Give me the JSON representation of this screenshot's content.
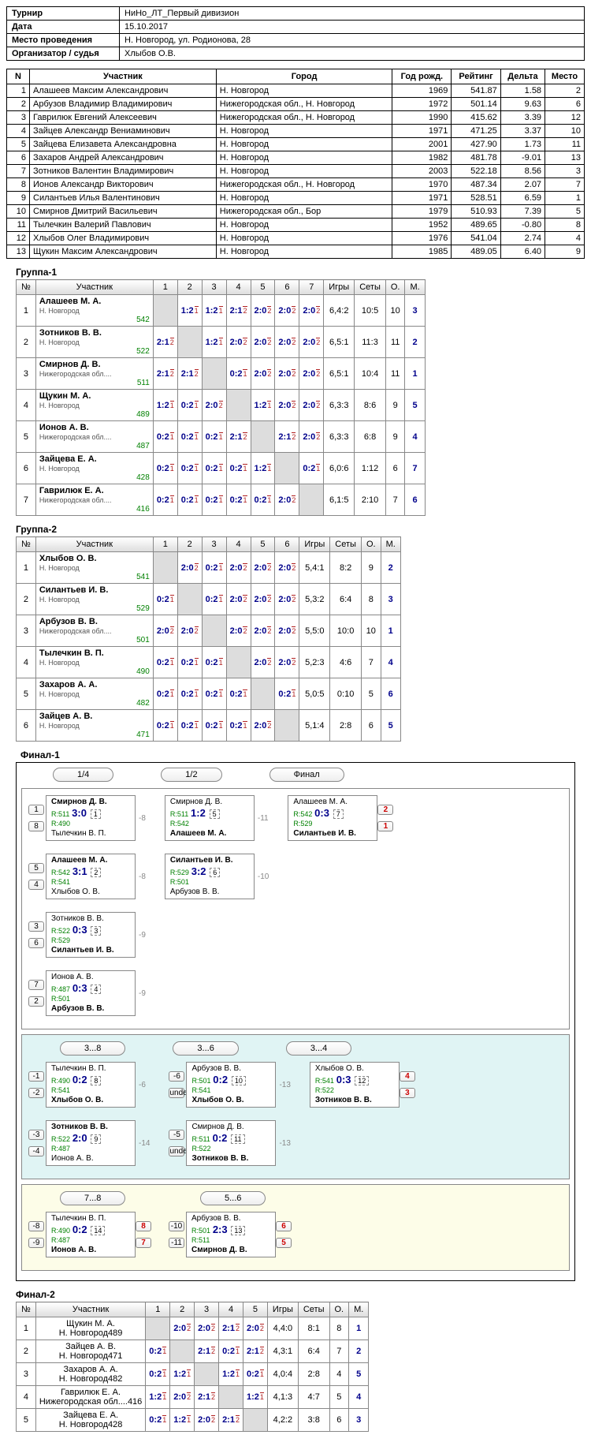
{
  "info": {
    "tournament_label": "Турнир",
    "tournament": "НиНо_ЛТ_Первый дивизион",
    "date_label": "Дата",
    "date": "15.10.2017",
    "venue_label": "Место проведения",
    "venue": "Н. Новгород, ул. Родионова, 28",
    "organizer_label": "Организатор / судья",
    "organizer": "Хлыбов О.В."
  },
  "main": {
    "headers": {
      "n": "N",
      "participant": "Участник",
      "city": "Город",
      "year": "Год рожд.",
      "rating": "Рейтинг",
      "delta": "Дельта",
      "place": "Место"
    },
    "rows": [
      {
        "n": 1,
        "name": "Алашеев Максим Александрович",
        "city": "Н. Новгород",
        "year": 1969,
        "rating": "541.87",
        "delta": "1.58",
        "place": 2
      },
      {
        "n": 2,
        "name": "Арбузов Владимир Владимирович",
        "city": "Нижегородская обл., Н. Новгород",
        "year": 1972,
        "rating": "501.14",
        "delta": "9.63",
        "place": 6
      },
      {
        "n": 3,
        "name": "Гаврилюк Евгений Алексеевич",
        "city": "Нижегородская обл., Н. Новгород",
        "year": 1990,
        "rating": "415.62",
        "delta": "3.39",
        "place": 12
      },
      {
        "n": 4,
        "name": "Зайцев Александр Вениаминович",
        "city": "Н. Новгород",
        "year": 1971,
        "rating": "471.25",
        "delta": "3.37",
        "place": 10
      },
      {
        "n": 5,
        "name": "Зайцева Елизавета Александровна",
        "city": "Н. Новгород",
        "year": 2001,
        "rating": "427.90",
        "delta": "1.73",
        "place": 11
      },
      {
        "n": 6,
        "name": "Захаров Андрей Александрович",
        "city": "Н. Новгород",
        "year": 1982,
        "rating": "481.78",
        "delta": "-9.01",
        "place": 13
      },
      {
        "n": 7,
        "name": "Зотников Валентин Владимирович",
        "city": "Н. Новгород",
        "year": 2003,
        "rating": "522.18",
        "delta": "8.56",
        "place": 3
      },
      {
        "n": 8,
        "name": "Ионов Александр Викторович",
        "city": "Нижегородская обл., Н. Новгород",
        "year": 1970,
        "rating": "487.34",
        "delta": "2.07",
        "place": 7
      },
      {
        "n": 9,
        "name": "Силантьев Илья Валентинович",
        "city": "Н. Новгород",
        "year": 1971,
        "rating": "528.51",
        "delta": "6.59",
        "place": 1
      },
      {
        "n": 10,
        "name": "Смирнов Дмитрий Васильевич",
        "city": "Нижегородская обл., Бор",
        "year": 1979,
        "rating": "510.93",
        "delta": "7.39",
        "place": 5
      },
      {
        "n": 11,
        "name": "Тылечкин Валерий Павлович",
        "city": "Н. Новгород",
        "year": 1952,
        "rating": "489.65",
        "delta": "-0.80",
        "place": 8
      },
      {
        "n": 12,
        "name": "Хлыбов Олег Владимирович",
        "city": "Н. Новгород",
        "year": 1976,
        "rating": "541.04",
        "delta": "2.74",
        "place": 4
      },
      {
        "n": 13,
        "name": "Щукин Максим Александрович",
        "city": "Н. Новгород",
        "year": 1985,
        "rating": "489.05",
        "delta": "6.40",
        "place": 9
      }
    ]
  },
  "groups": [
    {
      "title": "Группа-1",
      "cols": 7,
      "headers": {
        "n": "№",
        "p": "Участник",
        "g": "Игры",
        "s": "Сеты",
        "o": "О.",
        "m": "М."
      },
      "rows": [
        {
          "n": 1,
          "name": "Алашеев М. А.",
          "city": "Н. Новгород",
          "rt": 542,
          "cells": [
            "",
            "1:2/1",
            "1:2/1",
            "2:1/2",
            "2:0/2",
            "2:0/2",
            "2:0/2"
          ],
          "g": "6,4:2",
          "s": "10:5",
          "o": 10,
          "m": 3
        },
        {
          "n": 2,
          "name": "Зотников В. В.",
          "city": "Н. Новгород",
          "rt": 522,
          "cells": [
            "2:1/2",
            "",
            "1:2/1",
            "2:0/2",
            "2:0/2",
            "2:0/2",
            "2:0/2"
          ],
          "g": "6,5:1",
          "s": "11:3",
          "o": 11,
          "m": 2
        },
        {
          "n": 3,
          "name": "Смирнов Д. В.",
          "city": "Нижегородская обл....",
          "rt": 511,
          "cells": [
            "2:1/2",
            "2:1/2",
            "",
            "0:2/1",
            "2:0/2",
            "2:0/2",
            "2:0/2"
          ],
          "g": "6,5:1",
          "s": "10:4",
          "o": 11,
          "m": 1
        },
        {
          "n": 4,
          "name": "Щукин М. А.",
          "city": "Н. Новгород",
          "rt": 489,
          "cells": [
            "1:2/1",
            "0:2/1",
            "2:0/2",
            "",
            "1:2/1",
            "2:0/2",
            "2:0/2"
          ],
          "g": "6,3:3",
          "s": "8:6",
          "o": 9,
          "m": 5
        },
        {
          "n": 5,
          "name": "Ионов А. В.",
          "city": "Нижегородская обл....",
          "rt": 487,
          "cells": [
            "0:2/1",
            "0:2/1",
            "0:2/1",
            "2:1/2",
            "",
            "2:1/2",
            "2:0/2"
          ],
          "g": "6,3:3",
          "s": "6:8",
          "o": 9,
          "m": 4
        },
        {
          "n": 6,
          "name": "Зайцева Е. А.",
          "city": "Н. Новгород",
          "rt": 428,
          "cells": [
            "0:2/1",
            "0:2/1",
            "0:2/1",
            "0:2/1",
            "1:2/1",
            "",
            "0:2/1"
          ],
          "g": "6,0:6",
          "s": "1:12",
          "o": 6,
          "m": 7
        },
        {
          "n": 7,
          "name": "Гаврилюк Е. А.",
          "city": "Нижегородская обл....",
          "rt": 416,
          "cells": [
            "0:2/1",
            "0:2/1",
            "0:2/1",
            "0:2/1",
            "0:2/1",
            "2:0/2",
            ""
          ],
          "g": "6,1:5",
          "s": "2:10",
          "o": 7,
          "m": 6
        }
      ]
    },
    {
      "title": "Группа-2",
      "cols": 6,
      "headers": {
        "n": "№",
        "p": "Участник",
        "g": "Игры",
        "s": "Сеты",
        "o": "О.",
        "m": "М."
      },
      "rows": [
        {
          "n": 1,
          "name": "Хлыбов О. В.",
          "city": "Н. Новгород",
          "rt": 541,
          "cells": [
            "",
            "2:0/2",
            "0:2/1",
            "2:0/2",
            "2:0/2",
            "2:0/2"
          ],
          "g": "5,4:1",
          "s": "8:2",
          "o": 9,
          "m": 2
        },
        {
          "n": 2,
          "name": "Силантьев И. В.",
          "city": "Н. Новгород",
          "rt": 529,
          "cells": [
            "0:2/1",
            "",
            "0:2/1",
            "2:0/2",
            "2:0/2",
            "2:0/2"
          ],
          "g": "5,3:2",
          "s": "6:4",
          "o": 8,
          "m": 3
        },
        {
          "n": 3,
          "name": "Арбузов В. В.",
          "city": "Нижегородская обл....",
          "rt": 501,
          "cells": [
            "2:0/2",
            "2:0/2",
            "",
            "2:0/2",
            "2:0/2",
            "2:0/2"
          ],
          "g": "5,5:0",
          "s": "10:0",
          "o": 10,
          "m": 1
        },
        {
          "n": 4,
          "name": "Тылечкин В. П.",
          "city": "Н. Новгород",
          "rt": 490,
          "cells": [
            "0:2/1",
            "0:2/1",
            "0:2/1",
            "",
            "2:0/2",
            "2:0/2"
          ],
          "g": "5,2:3",
          "s": "4:6",
          "o": 7,
          "m": 4
        },
        {
          "n": 5,
          "name": "Захаров А. А.",
          "city": "Н. Новгород",
          "rt": 482,
          "cells": [
            "0:2/1",
            "0:2/1",
            "0:2/1",
            "0:2/1",
            "",
            "0:2/1"
          ],
          "g": "5,0:5",
          "s": "0:10",
          "o": 5,
          "m": 6
        },
        {
          "n": 6,
          "name": "Зайцев А. В.",
          "city": "Н. Новгород",
          "rt": 471,
          "cells": [
            "0:2/1",
            "0:2/1",
            "0:2/1",
            "0:2/1",
            "2:0/2",
            ""
          ],
          "g": "5,1:4",
          "s": "2:8",
          "o": 6,
          "m": 5
        }
      ]
    }
  ],
  "final1": {
    "title": "Финал-1",
    "rounds": [
      "1/4",
      "1/2",
      "Финал"
    ],
    "qf": [
      {
        "s1": "1",
        "s2": "8",
        "p1": "Смирнов Д. В.",
        "r1": "R:511",
        "p2": "Тылечкин В. П.",
        "r2": "R:490",
        "score": "3:0",
        "mnum": "1",
        "diff": "-8",
        "win": 1
      },
      {
        "s1": "5",
        "s2": "4",
        "p1": "Алашеев М. А.",
        "r1": "R:542",
        "p2": "Хлыбов О. В.",
        "r2": "R:541",
        "score": "3:1",
        "mnum": "2",
        "diff": "-8",
        "win": 1
      },
      {
        "s1": "3",
        "s2": "6",
        "p1": "Зотников В. В.",
        "r1": "R:522",
        "p2": "Силантьев И. В.",
        "r2": "R:529",
        "score": "0:3",
        "mnum": "3",
        "diff": "-9",
        "win": 2
      },
      {
        "s1": "7",
        "s2": "2",
        "p1": "Ионов А. В.",
        "r1": "R:487",
        "p2": "Арбузов В. В.",
        "r2": "R:501",
        "score": "0:3",
        "mnum": "4",
        "diff": "-9",
        "win": 2
      }
    ],
    "sf": [
      {
        "p1": "Смирнов Д. В.",
        "r1": "R:511",
        "p2": "Алашеев М. А.",
        "r2": "R:542",
        "score": "1:2",
        "mnum": "5",
        "diff": "-11",
        "win": 2
      },
      {
        "p1": "Силантьев И. В.",
        "r1": "R:529",
        "p2": "Арбузов В. В.",
        "r2": "R:501",
        "score": "3:2",
        "mnum": "6",
        "diff": "-10",
        "win": 1
      }
    ],
    "f": {
      "p1": "Алашеев М. А.",
      "r1": "R:542",
      "p2": "Силантьев И. В.",
      "r2": "R:529",
      "score": "0:3",
      "mnum": "7",
      "s1": "2",
      "s2": "1",
      "win": 2
    },
    "cons1": {
      "label1": "3...8",
      "label2": "3...6",
      "label3": "3...4",
      "r1": [
        {
          "s1": "-1",
          "s2": "-2",
          "p1": "Тылечкин В. П.",
          "r1": "R:490",
          "p2": "Хлыбов О. В.",
          "r2": "R:541",
          "score": "0:2",
          "mnum": "8",
          "diff": "-6",
          "win": 2
        },
        {
          "s1": "-3",
          "s2": "-4",
          "p1": "Зотников В. В.",
          "r1": "R:522",
          "p2": "Ионов А. В.",
          "r2": "R:487",
          "score": "2:0",
          "mnum": "9",
          "diff": "-14",
          "win": 1
        }
      ],
      "r2": [
        {
          "s1": "-6",
          "p1": "Арбузов В. В.",
          "r1": "R:501",
          "p2": "Хлыбов О. В.",
          "r2": "R:541",
          "score": "0:2",
          "mnum": "10",
          "diff": "-13",
          "win": 2
        },
        {
          "s1": "-5",
          "p1": "Смирнов Д. В.",
          "r1": "R:511",
          "p2": "Зотников В. В.",
          "r2": "R:522",
          "score": "0:2",
          "mnum": "11",
          "diff": "-13",
          "win": 2
        }
      ],
      "r3": {
        "p1": "Хлыбов О. В.",
        "r1": "R:541",
        "p2": "Зотников В. В.",
        "r2": "R:522",
        "score": "0:3",
        "mnum": "12",
        "s1": "4",
        "s2": "3",
        "win": 2
      }
    },
    "cons2": {
      "label1": "7...8",
      "label2": "5...6",
      "m1": {
        "s1": "-8",
        "s2": "-9",
        "p1": "Тылечкин В. П.",
        "r1": "R:490",
        "p2": "Ионов А. В.",
        "r2": "R:487",
        "score": "0:2",
        "mnum": "14",
        "rs1": "8",
        "rs2": "7",
        "win": 2
      },
      "m2": {
        "s1": "-10",
        "s2": "-11",
        "p1": "Арбузов В. В.",
        "r1": "R:501",
        "p2": "Смирнов Д. В.",
        "r2": "R:511",
        "score": "2:3",
        "mnum": "13",
        "rs1": "6",
        "rs2": "5",
        "win": 2
      }
    }
  },
  "final2": {
    "title": "Финал-2",
    "cols": 5,
    "headers": {
      "n": "№",
      "p": "Участник",
      "g": "Игры",
      "s": "Сеты",
      "o": "О.",
      "m": "М."
    },
    "rows": [
      {
        "n": 1,
        "name": "Щукин М. А.",
        "city": "Н. Новгород",
        "rt": 489,
        "cells": [
          "",
          "2:0/2",
          "2:0/2",
          "2:1/2",
          "2:0/2"
        ],
        "g": "4,4:0",
        "s": "8:1",
        "o": 8,
        "m": 1
      },
      {
        "n": 2,
        "name": "Зайцев А. В.",
        "city": "Н. Новгород",
        "rt": 471,
        "cells": [
          "0:2/1",
          "",
          "2:1/2",
          "0:2/1",
          "2:1/2"
        ],
        "g": "4,3:1",
        "s": "6:4",
        "o": 7,
        "m": 2
      },
      {
        "n": 3,
        "name": "Захаров А. А.",
        "city": "Н. Новгород",
        "rt": 482,
        "cells": [
          "0:2/1",
          "1:2/1",
          "",
          "1:2/1",
          "0:2/1"
        ],
        "g": "4,0:4",
        "s": "2:8",
        "o": 4,
        "m": 5
      },
      {
        "n": 4,
        "name": "Гаврилюк Е. А.",
        "city": "Нижегородская обл....",
        "rt": 416,
        "cells": [
          "1:2/1",
          "2:0/2",
          "2:1/2",
          "",
          "1:2/1"
        ],
        "g": "4,1:3",
        "s": "4:7",
        "o": 5,
        "m": 4
      },
      {
        "n": 5,
        "name": "Зайцева Е. А.",
        "city": "Н. Новгород",
        "rt": 428,
        "cells": [
          "0:2/1",
          "1:2/1",
          "2:0/2",
          "2:1/2",
          ""
        ],
        "g": "4,2:2",
        "s": "3:8",
        "o": 6,
        "m": 3
      }
    ]
  }
}
